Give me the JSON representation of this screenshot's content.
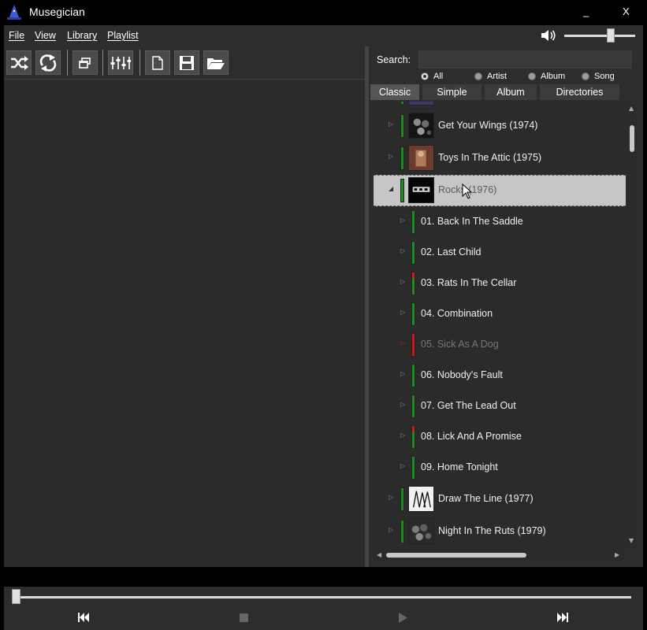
{
  "window": {
    "title": "Musegician",
    "minimize": "_",
    "close": "X"
  },
  "menu": {
    "file": "File",
    "view": "View",
    "library": "Library",
    "playlist": "Playlist"
  },
  "volume": {
    "level": 0.65
  },
  "toolbar": {
    "buttons": [
      "shuffle-icon",
      "repeat-icon",
      "window-restore-icon",
      "equalizer-icon",
      "new-file-icon",
      "save-icon",
      "open-folder-icon"
    ]
  },
  "search": {
    "label": "Search:",
    "value": "",
    "placeholder": ""
  },
  "filters": {
    "all": "All",
    "artist": "Artist",
    "album": "Album",
    "song": "Song",
    "selected": "All"
  },
  "tabs": {
    "classic": "Classic",
    "simple": "Simple",
    "album": "Album",
    "directories": "Directories",
    "active": "Classic"
  },
  "tree": {
    "albums": [
      {
        "label": "Get Your Wings (1974)",
        "expanded": false
      },
      {
        "label": "Toys In The Attic (1975)",
        "expanded": false
      },
      {
        "label": "Rocks (1976)",
        "expanded": true,
        "selected": true
      },
      {
        "label": "Draw The Line (1977)",
        "expanded": false
      },
      {
        "label": "Night In The Ruts (1979)",
        "expanded": false
      }
    ],
    "songs": [
      {
        "label": "01. Back In The Saddle",
        "rating": "green"
      },
      {
        "label": "02. Last Child",
        "rating": "green"
      },
      {
        "label": "03. Rats In The Cellar",
        "rating": "red-green"
      },
      {
        "label": "04. Combination",
        "rating": "green"
      },
      {
        "label": "05. Sick As A Dog",
        "rating": "red",
        "disabled": true
      },
      {
        "label": "06. Nobody's Fault",
        "rating": "green"
      },
      {
        "label": "07. Get The Lead Out",
        "rating": "green"
      },
      {
        "label": "08. Lick And A Promise",
        "rating": "red-green"
      },
      {
        "label": "09. Home Tonight",
        "rating": "green"
      }
    ]
  },
  "player": {
    "position": 0.0
  },
  "colors": {
    "green": "#1f8a1f",
    "red": "#cc1a1a",
    "panel": "#2d2d2d",
    "selection": "#c6c6c6"
  }
}
